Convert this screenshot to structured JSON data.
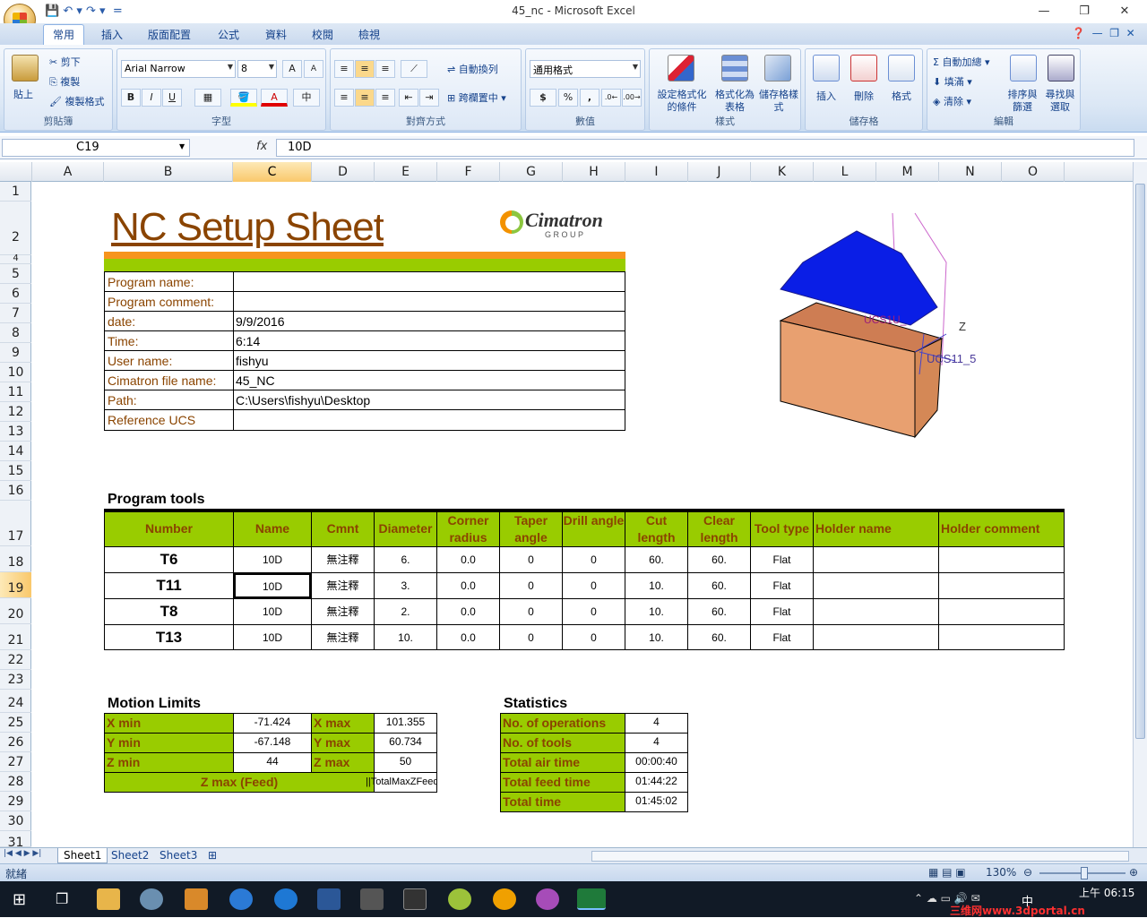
{
  "window": {
    "title": "45_nc - Microsoft Excel"
  },
  "tabs": [
    "常用",
    "插入",
    "版面配置",
    "公式",
    "資料",
    "校閱",
    "檢視"
  ],
  "ribbon": {
    "clipboard": {
      "paste": "貼上",
      "cut": "剪下",
      "copy": "複製",
      "format_painter": "複製格式",
      "label": "剪貼簿"
    },
    "font": {
      "name": "Arial Narrow",
      "size": "8",
      "label": "字型",
      "bold": "B",
      "italic": "I",
      "underline": "U"
    },
    "alignment": {
      "wrap": "自動換列",
      "merge": "跨欄置中",
      "label": "對齊方式"
    },
    "number": {
      "format": "通用格式",
      "currency": "$",
      "percent": "%",
      "comma": ",",
      "label": "數值"
    },
    "styles": {
      "conditional": "設定格式化的條件",
      "as_table": "格式化為表格",
      "cell_styles": "儲存格樣式",
      "label": "樣式"
    },
    "cells": {
      "insert": "插入",
      "delete": "刪除",
      "format": "格式",
      "label": "儲存格"
    },
    "editing": {
      "autosum": "自動加總",
      "fill": "填滿",
      "clear": "清除",
      "sort": "排序與篩選",
      "find": "尋找與選取",
      "label": "編輯"
    }
  },
  "formula_bar": {
    "name_box": "C19",
    "fx": "fx",
    "value": "10D"
  },
  "columns": [
    "A",
    "B",
    "C",
    "D",
    "E",
    "F",
    "G",
    "H",
    "I",
    "J",
    "K",
    "L",
    "M",
    "N",
    "O"
  ],
  "rows": [
    "1",
    "2",
    "4",
    "5",
    "6",
    "7",
    "8",
    "9",
    "10",
    "11",
    "12",
    "13",
    "14",
    "15",
    "16",
    "17",
    "18",
    "19",
    "20",
    "21",
    "22",
    "23",
    "24",
    "25",
    "26",
    "27",
    "28",
    "29",
    "30",
    "31"
  ],
  "sheet": {
    "title": "NC Setup Sheet",
    "logo": {
      "brand": "Cimatron",
      "sub": "G R O U P"
    },
    "info": [
      {
        "label": "Program name:",
        "value": ""
      },
      {
        "label": "Program comment:",
        "value": ""
      },
      {
        "label": "date:",
        "value": "9/9/2016"
      },
      {
        "label": "Time:",
        "value": "6:14"
      },
      {
        "label": "User name:",
        "value": "fishyu"
      },
      {
        "label": "Cimatron file name:",
        "value": "45_NC"
      },
      {
        "label": "Path:",
        "value": "C:\\Users\\fishyu\\Desktop"
      },
      {
        "label": "Reference UCS",
        "value": ""
      }
    ],
    "model_labels": {
      "ucs1": "UCS1U_",
      "ucs2": "UCS11_5",
      "axis_z": "Z"
    },
    "tools_title": "Program tools",
    "tools_headers": [
      "Number",
      "Name",
      "Cmnt",
      "Diameter",
      "Corner radius",
      "Taper angle",
      "Drill angle",
      "Cut length",
      "Clear length",
      "Tool type",
      "Holder name",
      "Holder comment"
    ],
    "tools": [
      [
        "T6",
        "10D",
        "無注釋",
        "6.",
        "0.0",
        "0",
        "0",
        "60.",
        "60.",
        "Flat",
        "",
        ""
      ],
      [
        "T11",
        "10D",
        "無注釋",
        "3.",
        "0.0",
        "0",
        "0",
        "10.",
        "60.",
        "Flat",
        "",
        ""
      ],
      [
        "T8",
        "10D",
        "無注釋",
        "2.",
        "0.0",
        "0",
        "0",
        "10.",
        "60.",
        "Flat",
        "",
        ""
      ],
      [
        "T13",
        "10D",
        "無注釋",
        "10.",
        "0.0",
        "0",
        "0",
        "10.",
        "60.",
        "Flat",
        "",
        ""
      ]
    ],
    "motion_title": "Motion Limits",
    "motion": {
      "xmin_label": "X min",
      "xmin": "-71.424",
      "xmax_label": "X max",
      "xmax": "101.355",
      "ymin_label": "Y min",
      "ymin": "-67.148",
      "ymax_label": "Y max",
      "ymax": "60.734",
      "zmin_label": "Z min",
      "zmin": "44",
      "zmaxl": "Z max",
      "zmax": "50",
      "zfeed_label": "Z max (Feed)",
      "zfeed": "||TotalMaxZFeed"
    },
    "stats_title": "Statistics",
    "stats": [
      {
        "label": "No. of operations",
        "value": "4"
      },
      {
        "label": "No. of tools",
        "value": "4"
      },
      {
        "label": "Total air time",
        "value": "00:00:40"
      },
      {
        "label": "Total feed time",
        "value": "01:44:22"
      },
      {
        "label": "Total time",
        "value": "01:45:02"
      }
    ]
  },
  "sheet_tabs": [
    "Sheet1",
    "Sheet2",
    "Sheet3"
  ],
  "status": {
    "ready": "就緒",
    "zoom": "130%"
  },
  "taskbar": {
    "time": "上午 06:15",
    "lang": "中",
    "watermark": "三维网www.3dportal.cn"
  }
}
